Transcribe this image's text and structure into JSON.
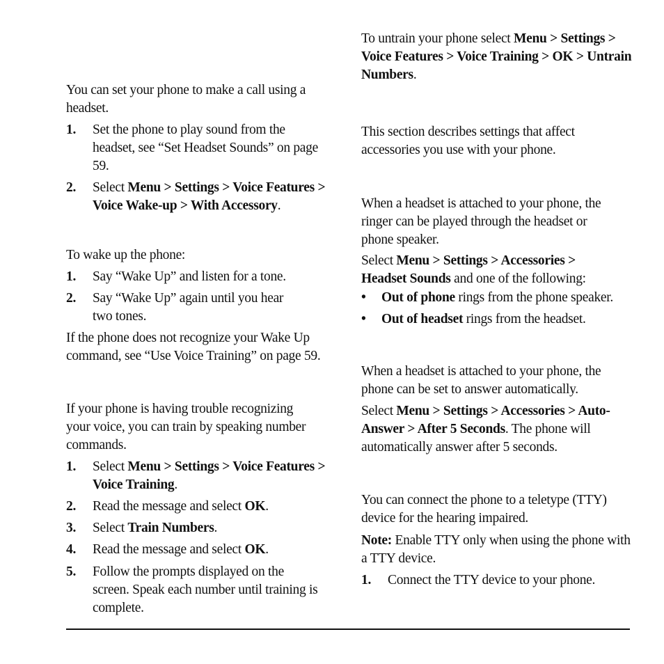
{
  "left_column": {
    "intro": "You can set your phone to make a call using a headset.",
    "headset_steps": [
      {
        "num": "1.",
        "text": "Set the phone to play sound from the headset, see “Set Headset Sounds” on page 59."
      },
      {
        "num": "2.",
        "pre": "Select ",
        "bold": "Menu > Settings > Voice Features > Voice Wake-up > With Accessory",
        "post": "."
      }
    ],
    "wake_intro": "To wake up the phone:",
    "wake_steps": [
      {
        "num": "1.",
        "text": "Say “Wake Up” and listen for a tone."
      },
      {
        "num": "2.",
        "text": "Say “Wake Up” again until you hear two tones."
      }
    ],
    "wake_note": "If the phone does not recognize your Wake Up command, see “Use Voice Training” on page 59.",
    "train_intro": "If your phone is having trouble recognizing your voice, you can train by speaking number commands.",
    "train_steps": [
      {
        "num": "1.",
        "pre": "Select ",
        "bold": "Menu > Settings > Voice Features > Voice Training",
        "post": "."
      },
      {
        "num": "2.",
        "pre": "Read the message and select ",
        "bold": "OK",
        "post": "."
      },
      {
        "num": "3.",
        "pre": "Select ",
        "bold": "Train Numbers",
        "post": "."
      },
      {
        "num": "4.",
        "pre": "Read the message and select ",
        "bold": "OK",
        "post": "."
      },
      {
        "num": "5.",
        "text": "Follow the prompts displayed on the screen. Speak each number until training is complete."
      }
    ]
  },
  "right_column": {
    "untrain": {
      "pre": "To untrain your phone select ",
      "bold": "Menu > Settings > Voice Features > Voice Training > OK > Untrain Numbers",
      "post": "."
    },
    "accessories_intro": "This section describes settings that affect accessories you use with your phone.",
    "headset_sounds_intro": "When a headset is attached to your phone, the ringer can be played through the headset or phone speaker.",
    "headset_sounds_select": {
      "pre": "Select ",
      "bold": "Menu > Settings > Accessories > Headset Sounds",
      "post": " and one of the following:"
    },
    "headset_sounds_options": [
      {
        "bullet": "•",
        "bold": "Out of phone",
        "text": " rings from the phone speaker."
      },
      {
        "bullet": "•",
        "bold": "Out of headset",
        "text": " rings from the headset."
      }
    ],
    "auto_answer_intro": "When a headset is attached to your phone, the phone can be set to answer automatically.",
    "auto_answer_select": {
      "pre": "Select ",
      "bold": "Menu > Settings > Accessories > Auto-Answer > After 5 Seconds",
      "post": ". The phone will automatically answer after 5 seconds."
    },
    "tty_intro": "You can connect the phone to a teletype (TTY) device for the hearing impaired.",
    "tty_note": {
      "bold": "Note:",
      "text": " Enable TTY only when using the phone with a TTY device."
    },
    "tty_steps": [
      {
        "num": "1.",
        "text": "Connect the TTY device to your phone."
      }
    ]
  }
}
